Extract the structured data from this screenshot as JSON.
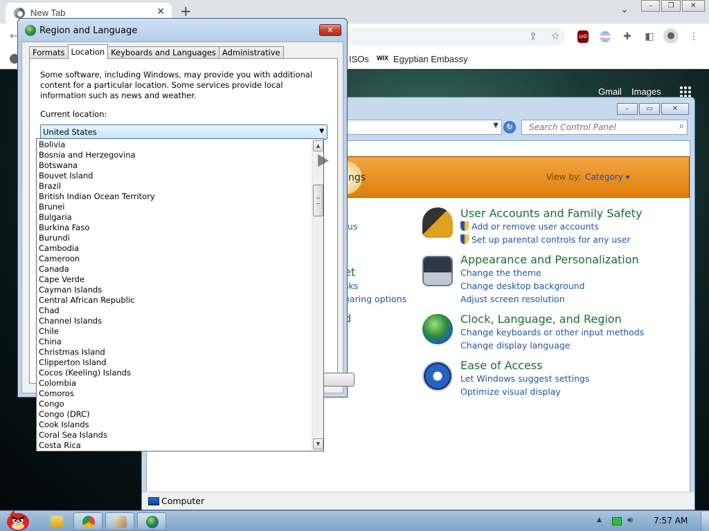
{
  "chrome": {
    "tab_title": "New Tab",
    "tab_close": "✕",
    "new_tab": "+",
    "bookmarks": [
      {
        "label": "ISOs"
      },
      {
        "label": "Egyptian Embassy",
        "icon_text": "WIX"
      }
    ],
    "ntp_links": {
      "gmail": "Gmail",
      "images": "Images"
    }
  },
  "region_dialog": {
    "title": "Region and Language",
    "tabs": [
      {
        "label": "Formats",
        "active": false
      },
      {
        "label": "Location",
        "active": true
      },
      {
        "label": "Keyboards and Languages",
        "active": false
      },
      {
        "label": "Administrative",
        "active": false
      }
    ],
    "description": "Some software, including Windows, may provide you with additional content for a particular location. Some services provide local information such as news and weather.",
    "current_location_label": "Current location:",
    "current_location_value": "United States",
    "location_options": [
      "Bolivia",
      "Bosnia and Herzegovina",
      "Botswana",
      "Bouvet Island",
      "Brazil",
      "British Indian Ocean Territory",
      "Brunei",
      "Bulgaria",
      "Burkina Faso",
      "Burundi",
      "Cambodia",
      "Cameroon",
      "Canada",
      "Cape Verde",
      "Cayman Islands",
      "Central African Republic",
      "Chad",
      "Channel Islands",
      "Chile",
      "China",
      "Christmas Island",
      "Clipperton Island",
      "Cocos (Keeling) Islands",
      "Colombia",
      "Comoros",
      "Congo",
      "Congo (DRC)",
      "Cook Islands",
      "Coral Sea Islands",
      "Costa Rica"
    ]
  },
  "control_panel": {
    "search_placeholder": "Search Control Panel",
    "banner_partial": "ngs",
    "view_by_label": "View by:",
    "view_by_value": "Category",
    "partial_left": [
      {
        "text": "tus"
      },
      {
        "text": "et"
      },
      {
        "text": "sks"
      },
      {
        "text": "haring options"
      },
      {
        "text": "d"
      }
    ],
    "categories": [
      {
        "title": "User Accounts and Family Safety",
        "links": [
          "Add or remove user accounts",
          "Set up parental controls for any user"
        ]
      },
      {
        "title": "Appearance and Personalization",
        "links": [
          "Change the theme",
          "Change desktop background",
          "Adjust screen resolution"
        ]
      },
      {
        "title": "Clock, Language, and Region",
        "links": [
          "Change keyboards or other input methods",
          "Change display language"
        ]
      },
      {
        "title": "Ease of Access",
        "links": [
          "Let Windows suggest settings",
          "Optimize visual display"
        ]
      }
    ],
    "status_text": "Computer"
  },
  "taskbar": {
    "clock": "7:57 AM"
  },
  "colors": {
    "category_title": "#1a6f2d",
    "category_link": "#1d56a8",
    "banner_orange": "#e07f0c",
    "dialog_close_red": "#c7402c"
  }
}
